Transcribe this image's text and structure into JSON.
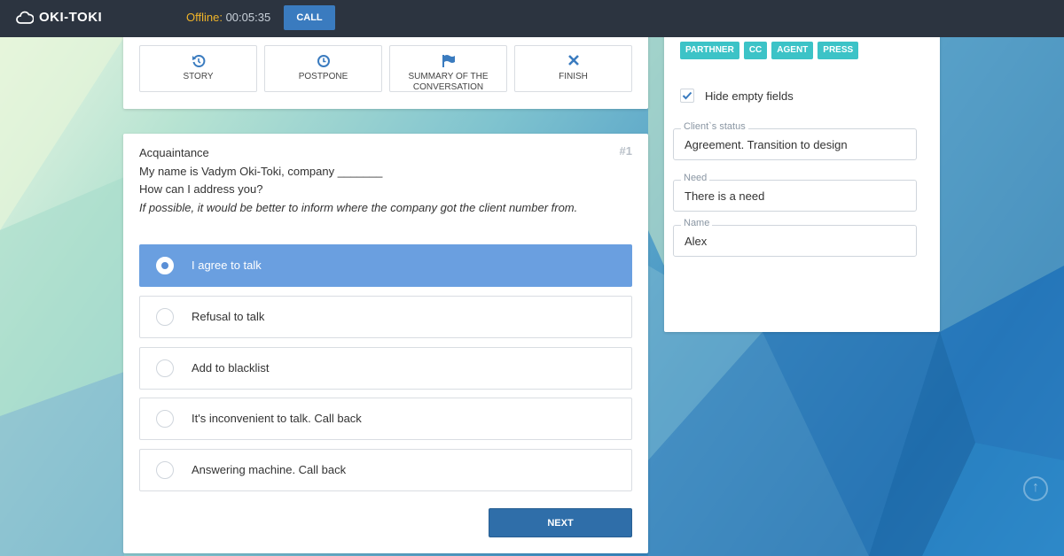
{
  "header": {
    "logo_text": "OKI-TOKI",
    "status_label": "Offline:",
    "timer": "00:05:35",
    "call_label": "CALL"
  },
  "actions": [
    {
      "label": "STORY",
      "icon": "history-icon"
    },
    {
      "label": "POSTPONE",
      "icon": "clock-icon"
    },
    {
      "label": "SUMMARY OF THE CONVERSATION",
      "icon": "flag-icon"
    },
    {
      "label": "FINISH",
      "icon": "close-icon"
    }
  ],
  "script": {
    "step_number": "#1",
    "lines": [
      "Acquaintance",
      "My name is Vadym Oki-Toki, company _______",
      "How can I address you?"
    ],
    "hint": "If possible, it would be better to inform where the company got the client number from.",
    "options": [
      {
        "label": "I agree to talk",
        "selected": true
      },
      {
        "label": "Refusal to talk",
        "selected": false
      },
      {
        "label": "Add to blacklist",
        "selected": false
      },
      {
        "label": "It's inconvenient to talk. Call back",
        "selected": false
      },
      {
        "label": "Answering machine. Call back",
        "selected": false
      }
    ],
    "next_label": "NEXT"
  },
  "info": {
    "tags": [
      "PARTHNER",
      "CC",
      "AGENT",
      "PRESS"
    ],
    "hide_empty_label": "Hide empty fields",
    "hide_empty_checked": true,
    "fields": [
      {
        "label": "Client`s status",
        "value": "Agreement. Transition to design"
      },
      {
        "label": "Need",
        "value": "There is a need"
      },
      {
        "label": "Name",
        "value": "Alex"
      }
    ]
  },
  "colors": {
    "topbar": "#2c3440",
    "offline": "#f0b429",
    "primary": "#2f6ea9",
    "selected_option": "#6a9fe0",
    "tag": "#3cc3c7"
  }
}
